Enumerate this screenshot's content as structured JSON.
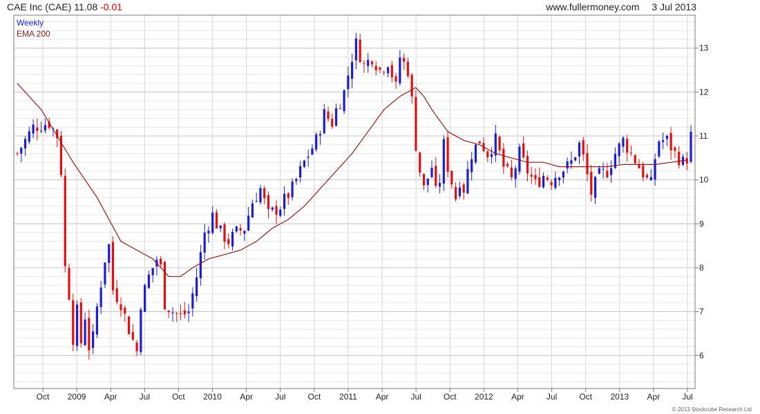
{
  "header": {
    "title": "CAE Inc (CAE)",
    "price": "11.08",
    "change": "-0.01",
    "site": "www.fullermoney.com",
    "date": "3 Jul 2013"
  },
  "legend": {
    "period": "Weekly",
    "ema": "EMA 200",
    "period_color": "#1c1cd0",
    "ema_color": "#8b1a1a"
  },
  "copyright": "© 2013 Stockcube Research Ltd",
  "chart_data": {
    "type": "candlestick",
    "interval": "weekly",
    "ylim": [
      5.25,
      13.75
    ],
    "yticks": [
      6,
      7,
      8,
      9,
      10,
      11,
      12,
      13
    ],
    "xticks": [
      "Oct",
      "2009",
      "Apr",
      "Jul",
      "Oct",
      "2010",
      "Apr",
      "Jul",
      "Oct",
      "2011",
      "Apr",
      "Jul",
      "Oct",
      "2012",
      "Apr",
      "Jul",
      "Oct",
      "2013",
      "Apr",
      "Jul"
    ],
    "grid": true,
    "up_color": "#1c1cd0",
    "down_color": "#e01010",
    "close_path": [
      [
        0,
        10.6
      ],
      [
        4,
        11.2
      ],
      [
        8,
        11.3
      ],
      [
        10,
        11.0
      ],
      [
        11,
        10.2
      ],
      [
        12,
        8.0
      ],
      [
        13,
        7.4
      ],
      [
        14,
        6.4
      ],
      [
        15,
        7.0
      ],
      [
        16,
        6.3
      ],
      [
        17,
        6.9
      ],
      [
        18,
        6.2
      ],
      [
        19,
        6.4
      ],
      [
        20,
        7.1
      ],
      [
        22,
        8.2
      ],
      [
        23,
        8.5
      ],
      [
        24,
        7.5
      ],
      [
        26,
        7.2
      ],
      [
        28,
        6.6
      ],
      [
        30,
        6.1
      ],
      [
        31,
        7.2
      ],
      [
        33,
        7.8
      ],
      [
        35,
        8.2
      ],
      [
        36,
        8.0
      ],
      [
        37,
        7.2
      ],
      [
        39,
        7.0
      ],
      [
        41,
        6.9
      ],
      [
        43,
        7.0
      ],
      [
        45,
        7.8
      ],
      [
        47,
        8.8
      ],
      [
        49,
        9.2
      ],
      [
        51,
        8.8
      ],
      [
        53,
        8.6
      ],
      [
        55,
        8.8
      ],
      [
        57,
        8.9
      ],
      [
        59,
        9.5
      ],
      [
        61,
        9.8
      ],
      [
        63,
        9.2
      ],
      [
        66,
        9.4
      ],
      [
        69,
        9.8
      ],
      [
        72,
        10.4
      ],
      [
        75,
        10.9
      ],
      [
        77,
        11.5
      ],
      [
        79,
        11.3
      ],
      [
        80,
        11.6
      ],
      [
        82,
        12.0
      ],
      [
        84,
        12.8
      ],
      [
        85,
        13.1
      ],
      [
        87,
        12.6
      ],
      [
        89,
        12.8
      ],
      [
        91,
        12.5
      ],
      [
        93,
        12.7
      ],
      [
        95,
        12.1
      ],
      [
        96,
        12.8
      ],
      [
        98,
        12.5
      ],
      [
        99,
        11.8
      ],
      [
        100,
        10.8
      ],
      [
        101,
        10.2
      ],
      [
        102,
        9.8
      ],
      [
        104,
        10.3
      ],
      [
        105,
        9.7
      ],
      [
        106,
        10.0
      ],
      [
        107,
        10.8
      ],
      [
        108,
        10.3
      ],
      [
        110,
        9.6
      ],
      [
        111,
        10.0
      ],
      [
        112,
        9.8
      ],
      [
        114,
        10.6
      ],
      [
        116,
        10.9
      ],
      [
        118,
        10.6
      ],
      [
        120,
        10.9
      ],
      [
        122,
        10.3
      ],
      [
        124,
        10.0
      ],
      [
        126,
        10.6
      ],
      [
        128,
        10.2
      ],
      [
        130,
        9.9
      ],
      [
        132,
        10.1
      ],
      [
        134,
        10.0
      ],
      [
        136,
        10.2
      ],
      [
        138,
        10.3
      ],
      [
        139,
        10.4
      ],
      [
        141,
        10.8
      ],
      [
        142,
        10.5
      ],
      [
        143,
        10.1
      ],
      [
        144,
        9.7
      ],
      [
        146,
        10.1
      ],
      [
        148,
        10.2
      ],
      [
        150,
        10.6
      ],
      [
        152,
        10.9
      ],
      [
        154,
        10.6
      ],
      [
        156,
        10.3
      ],
      [
        158,
        10.0
      ],
      [
        159,
        9.9
      ],
      [
        160,
        10.5
      ],
      [
        161,
        10.9
      ],
      [
        163,
        10.9
      ],
      [
        165,
        10.6
      ],
      [
        167,
        10.4
      ],
      [
        168,
        10.5
      ],
      [
        169,
        11.0
      ]
    ],
    "ema_path": [
      [
        0,
        12.2
      ],
      [
        6,
        11.6
      ],
      [
        10,
        11.0
      ],
      [
        14,
        10.4
      ],
      [
        20,
        9.6
      ],
      [
        26,
        8.6
      ],
      [
        30,
        8.4
      ],
      [
        34,
        8.2
      ],
      [
        38,
        7.8
      ],
      [
        41,
        7.8
      ],
      [
        44,
        8.0
      ],
      [
        48,
        8.2
      ],
      [
        52,
        8.3
      ],
      [
        56,
        8.4
      ],
      [
        60,
        8.6
      ],
      [
        64,
        8.9
      ],
      [
        68,
        9.1
      ],
      [
        72,
        9.4
      ],
      [
        76,
        9.8
      ],
      [
        80,
        10.2
      ],
      [
        84,
        10.6
      ],
      [
        88,
        11.1
      ],
      [
        92,
        11.6
      ],
      [
        96,
        11.9
      ],
      [
        100,
        12.1
      ],
      [
        102,
        11.9
      ],
      [
        104,
        11.6
      ],
      [
        108,
        11.1
      ],
      [
        112,
        10.9
      ],
      [
        116,
        10.8
      ],
      [
        120,
        10.6
      ],
      [
        124,
        10.5
      ],
      [
        128,
        10.4
      ],
      [
        132,
        10.4
      ],
      [
        136,
        10.3
      ],
      [
        140,
        10.3
      ],
      [
        144,
        10.3
      ],
      [
        148,
        10.3
      ],
      [
        152,
        10.35
      ],
      [
        156,
        10.35
      ],
      [
        160,
        10.35
      ],
      [
        164,
        10.4
      ],
      [
        168,
        10.45
      ]
    ],
    "n_weeks": 170
  }
}
